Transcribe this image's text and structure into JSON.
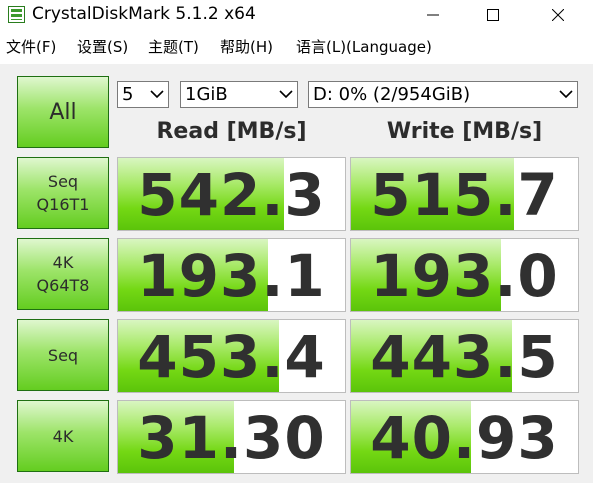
{
  "window": {
    "title": "CrystalDiskMark 5.1.2 x64",
    "accent": "#5bc40a"
  },
  "menu": [
    "文件(F)",
    "设置(S)",
    "主题(T)",
    "帮助(H)",
    "语言(L)(Language)"
  ],
  "controls": {
    "all_label": "All",
    "count": "5",
    "size": "1GiB",
    "drive": "D: 0% (2/954GiB)"
  },
  "headers": {
    "read": "Read [MB/s]",
    "write": "Write [MB/s]"
  },
  "tests": [
    {
      "label_line1": "Seq",
      "label_line2": "Q16T1",
      "read": "542.3",
      "write": "515.7",
      "read_fill": 0.73,
      "write_fill": 0.72
    },
    {
      "label_line1": "4K",
      "label_line2": "Q64T8",
      "read": "193.1",
      "write": "193.0",
      "read_fill": 0.66,
      "write_fill": 0.66
    },
    {
      "label_line1": "Seq",
      "label_line2": "",
      "read": "453.4",
      "write": "443.5",
      "read_fill": 0.71,
      "write_fill": 0.71
    },
    {
      "label_line1": "4K",
      "label_line2": "",
      "read": "31.30",
      "write": "40.93",
      "read_fill": 0.51,
      "write_fill": 0.53
    }
  ]
}
